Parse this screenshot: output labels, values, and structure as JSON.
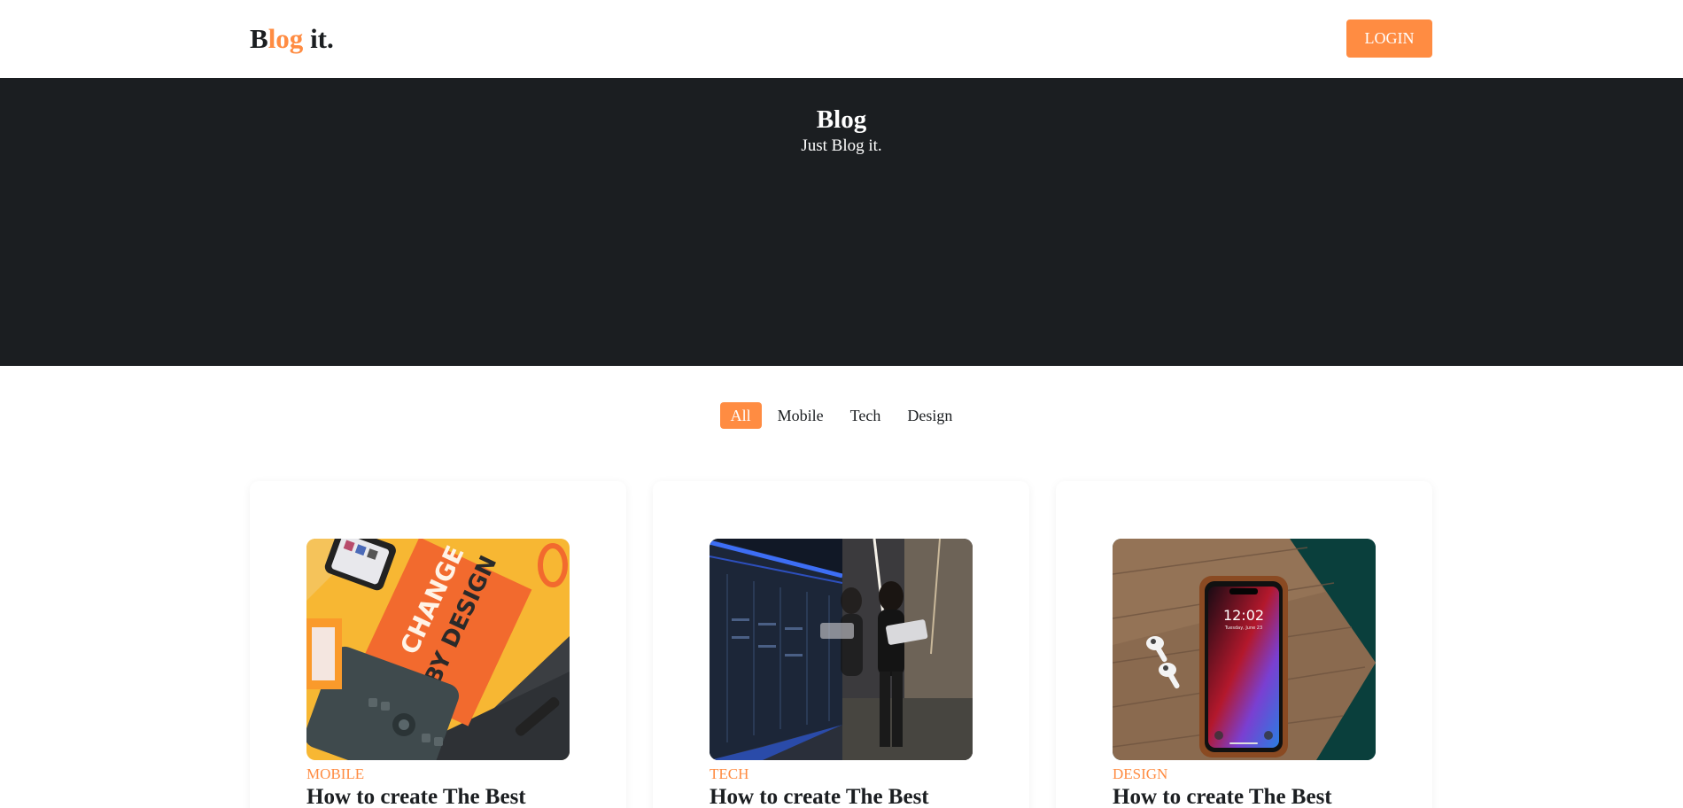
{
  "header": {
    "logo_prefix": "B",
    "logo_accent": "log",
    "logo_suffix": " it.",
    "login_label": "LOGIN"
  },
  "hero": {
    "title": "Blog",
    "subtitle": "Just Blog it."
  },
  "filters": [
    {
      "label": "All",
      "active": true
    },
    {
      "label": "Mobile",
      "active": false
    },
    {
      "label": "Tech",
      "active": false
    },
    {
      "label": "Design",
      "active": false
    }
  ],
  "posts": [
    {
      "category": "MOBILE",
      "title": "How to create The Best",
      "image": "design-book-flatlay-image"
    },
    {
      "category": "TECH",
      "title": "How to create The Best",
      "image": "server-room-person-laptop-image"
    },
    {
      "category": "DESIGN",
      "title": "How to create The Best",
      "image": "smartphone-earbuds-wood-image"
    }
  ],
  "colors": {
    "accent": "#ff8c42",
    "hero_background": "#1b1e21",
    "text": "#1b1e21"
  }
}
